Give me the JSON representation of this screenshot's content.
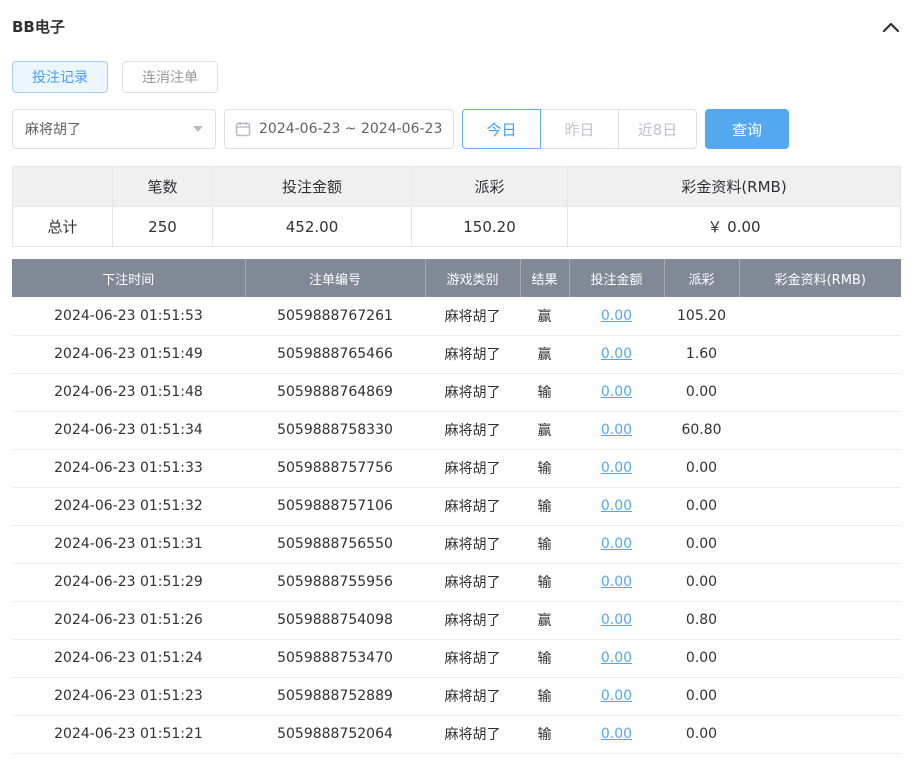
{
  "header": {
    "title": "BB电子"
  },
  "icons": {
    "collapse": "chevron-up",
    "select_caret": "chevron-down",
    "date": "calendar"
  },
  "colors": {
    "accent": "#54a8f0",
    "table_header_bg": "#818896",
    "summary_header_bg": "#f0f0f0"
  },
  "tabs": [
    {
      "label": "投注记录",
      "active": true
    },
    {
      "label": "连消注单",
      "active": false
    }
  ],
  "filters": {
    "game_select": "麻将胡了",
    "date_range": "2024-06-23 ~ 2024-06-23",
    "quick_buttons": [
      {
        "label": "今日",
        "active": true
      },
      {
        "label": "昨日",
        "active": false
      },
      {
        "label": "近8日",
        "active": false
      }
    ],
    "search_label": "查询"
  },
  "summary": {
    "headers": [
      "笔数",
      "投注金额",
      "派彩",
      "彩金资料(RMB)"
    ],
    "row_label": "总计",
    "values": [
      "250",
      "452.00",
      "150.20",
      "￥ 0.00"
    ]
  },
  "table": {
    "headers": [
      "下注时间",
      "注单编号",
      "游戏类别",
      "结果",
      "投注金额",
      "派彩",
      "彩金资料(RMB)"
    ],
    "col_keys": [
      "time",
      "order_id",
      "game",
      "result",
      "bet_amount",
      "payout",
      "bonus"
    ],
    "rows": [
      {
        "time": "2024-06-23 01:51:53",
        "order_id": "5059888767261",
        "game": "麻将胡了",
        "result": "赢",
        "bet_amount": "0.00",
        "payout": "105.20",
        "bonus": ""
      },
      {
        "time": "2024-06-23 01:51:49",
        "order_id": "5059888765466",
        "game": "麻将胡了",
        "result": "赢",
        "bet_amount": "0.00",
        "payout": "1.60",
        "bonus": ""
      },
      {
        "time": "2024-06-23 01:51:48",
        "order_id": "5059888764869",
        "game": "麻将胡了",
        "result": "输",
        "bet_amount": "0.00",
        "payout": "0.00",
        "bonus": ""
      },
      {
        "time": "2024-06-23 01:51:34",
        "order_id": "5059888758330",
        "game": "麻将胡了",
        "result": "赢",
        "bet_amount": "0.00",
        "payout": "60.80",
        "bonus": ""
      },
      {
        "time": "2024-06-23 01:51:33",
        "order_id": "5059888757756",
        "game": "麻将胡了",
        "result": "输",
        "bet_amount": "0.00",
        "payout": "0.00",
        "bonus": ""
      },
      {
        "time": "2024-06-23 01:51:32",
        "order_id": "5059888757106",
        "game": "麻将胡了",
        "result": "输",
        "bet_amount": "0.00",
        "payout": "0.00",
        "bonus": ""
      },
      {
        "time": "2024-06-23 01:51:31",
        "order_id": "5059888756550",
        "game": "麻将胡了",
        "result": "输",
        "bet_amount": "0.00",
        "payout": "0.00",
        "bonus": ""
      },
      {
        "time": "2024-06-23 01:51:29",
        "order_id": "5059888755956",
        "game": "麻将胡了",
        "result": "输",
        "bet_amount": "0.00",
        "payout": "0.00",
        "bonus": ""
      },
      {
        "time": "2024-06-23 01:51:26",
        "order_id": "5059888754098",
        "game": "麻将胡了",
        "result": "赢",
        "bet_amount": "0.00",
        "payout": "0.80",
        "bonus": ""
      },
      {
        "time": "2024-06-23 01:51:24",
        "order_id": "5059888753470",
        "game": "麻将胡了",
        "result": "输",
        "bet_amount": "0.00",
        "payout": "0.00",
        "bonus": ""
      },
      {
        "time": "2024-06-23 01:51:23",
        "order_id": "5059888752889",
        "game": "麻将胡了",
        "result": "输",
        "bet_amount": "0.00",
        "payout": "0.00",
        "bonus": ""
      },
      {
        "time": "2024-06-23 01:51:21",
        "order_id": "5059888752064",
        "game": "麻将胡了",
        "result": "输",
        "bet_amount": "0.00",
        "payout": "0.00",
        "bonus": ""
      }
    ]
  }
}
